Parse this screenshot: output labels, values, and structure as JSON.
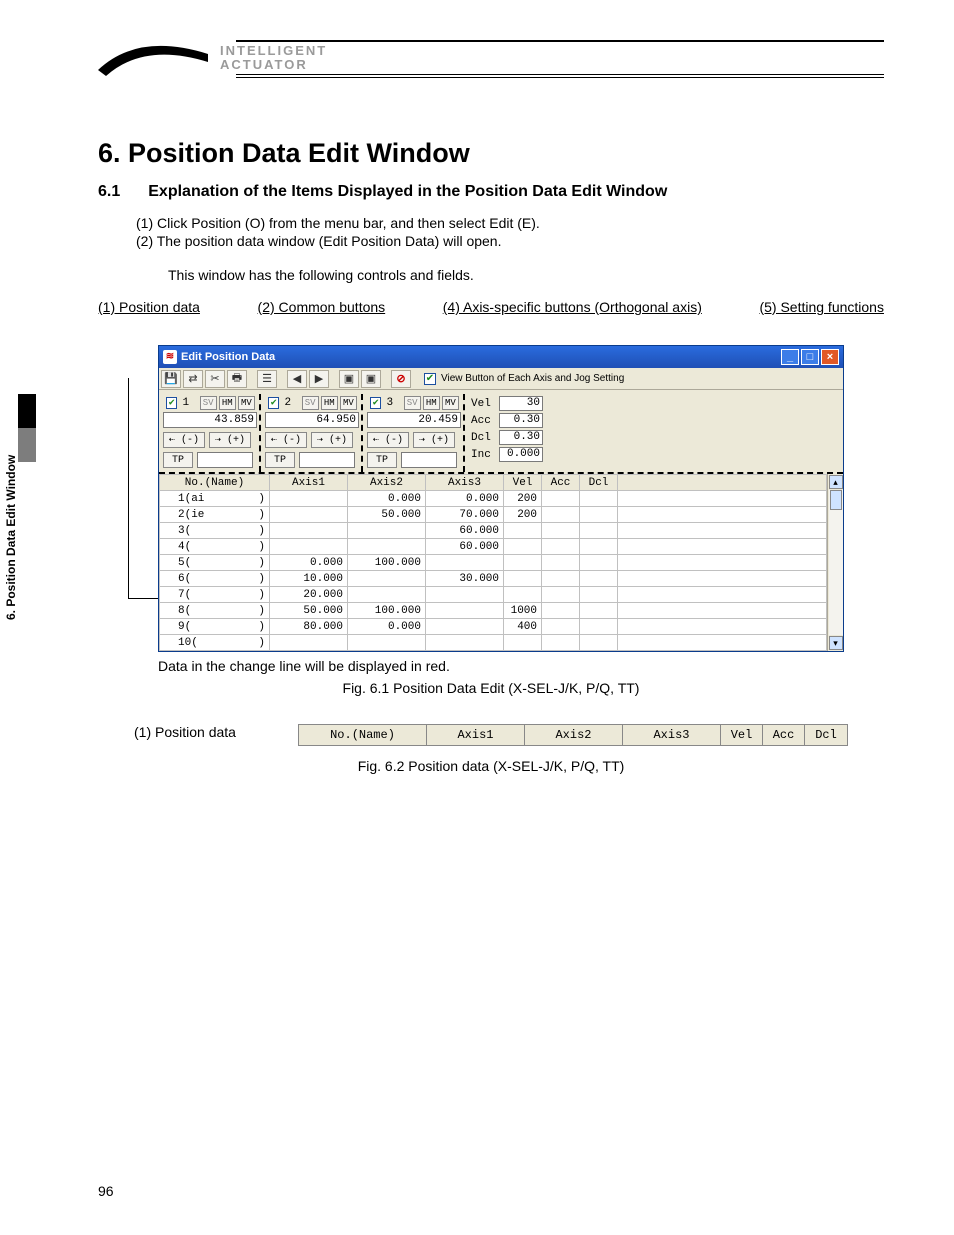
{
  "brand": {
    "line1": "INTELLIGENT",
    "line2": "ACTUATOR"
  },
  "side_tab": "6. Position Data Edit Window",
  "heading": "6.   Position Data Edit Window",
  "subheading_num": "6.1",
  "subheading_text": "Explanation of the Items Displayed in the Position Data Edit Window",
  "instructions": {
    "i1": "(1)   Click Position (O) from the menu bar, and then select Edit (E).",
    "i2": "(2)   The position data window (Edit Position Data) will open.",
    "i3": "This window has the following controls and fields."
  },
  "labels": {
    "l1": "(1) Position data",
    "l2": "(2) Common buttons",
    "l4": "(4) Axis-specific buttons (Orthogonal axis)",
    "l5": "(5) Setting functions"
  },
  "window": {
    "title": "Edit Position Data",
    "checkbox_label": "View Button of Each Axis and Jog Setting",
    "axes": [
      {
        "n": "1",
        "pos": "43.859"
      },
      {
        "n": "2",
        "pos": "64.950"
      },
      {
        "n": "3",
        "pos": "20.459"
      }
    ],
    "jog_settings": [
      {
        "lab": "Vel",
        "val": "30"
      },
      {
        "lab": "Acc",
        "val": "0.30"
      },
      {
        "lab": "Dcl",
        "val": "0.30"
      },
      {
        "lab": "Inc",
        "val": "0.000"
      }
    ],
    "axis_btn": {
      "sv": "SV",
      "hm": "HM",
      "mv": "MV",
      "jm": "⇠ (-)",
      "jp": "⇢ (+)",
      "tp": "TP"
    },
    "columns": [
      "No.(Name)",
      "Axis1",
      "Axis2",
      "Axis3",
      "Vel",
      "Acc",
      "Dcl"
    ],
    "rows": [
      {
        "no": "1(ai",
        "a1": "",
        "a2": "0.000",
        "a3": "0.000",
        "vel": "200",
        "acc": "",
        "dcl": ""
      },
      {
        "no": "2(ie",
        "a1": "",
        "a2": "50.000",
        "a3": "70.000",
        "vel": "200",
        "acc": "",
        "dcl": ""
      },
      {
        "no": "3(",
        "a1": "",
        "a2": "",
        "a3": "60.000",
        "vel": "",
        "acc": "",
        "dcl": ""
      },
      {
        "no": "4(",
        "a1": "",
        "a2": "",
        "a3": "60.000",
        "vel": "",
        "acc": "",
        "dcl": ""
      },
      {
        "no": "5(",
        "a1": "0.000",
        "a2": "100.000",
        "a3": "",
        "vel": "",
        "acc": "",
        "dcl": ""
      },
      {
        "no": "6(",
        "a1": "10.000",
        "a2": "",
        "a3": "30.000",
        "vel": "",
        "acc": "",
        "dcl": ""
      },
      {
        "no": "7(",
        "a1": "20.000",
        "a2": "",
        "a3": "",
        "vel": "",
        "acc": "",
        "dcl": ""
      },
      {
        "no": "8(",
        "a1": "50.000",
        "a2": "100.000",
        "a3": "",
        "vel": "1000",
        "acc": "",
        "dcl": ""
      },
      {
        "no": "9(",
        "a1": "80.000",
        "a2": "0.000",
        "a3": "",
        "vel": "400",
        "acc": "",
        "dcl": ""
      },
      {
        "no": "10(",
        "a1": "",
        "a2": "",
        "a3": "",
        "vel": "",
        "acc": "",
        "dcl": ""
      }
    ]
  },
  "caption_redline": "Data in the change line will be displayed in red.",
  "fig61": "Fig. 6.1 Position Data Edit (X-SEL-J/K, P/Q, TT)",
  "posdata_label": "(1)   Position data",
  "header_strip": [
    "No.(Name)",
    "Axis1",
    "Axis2",
    "Axis3",
    "Vel",
    "Acc",
    "Dcl"
  ],
  "fig62": "Fig. 6.2 Position data (X-SEL-J/K, P/Q, TT)",
  "page_number": "96"
}
